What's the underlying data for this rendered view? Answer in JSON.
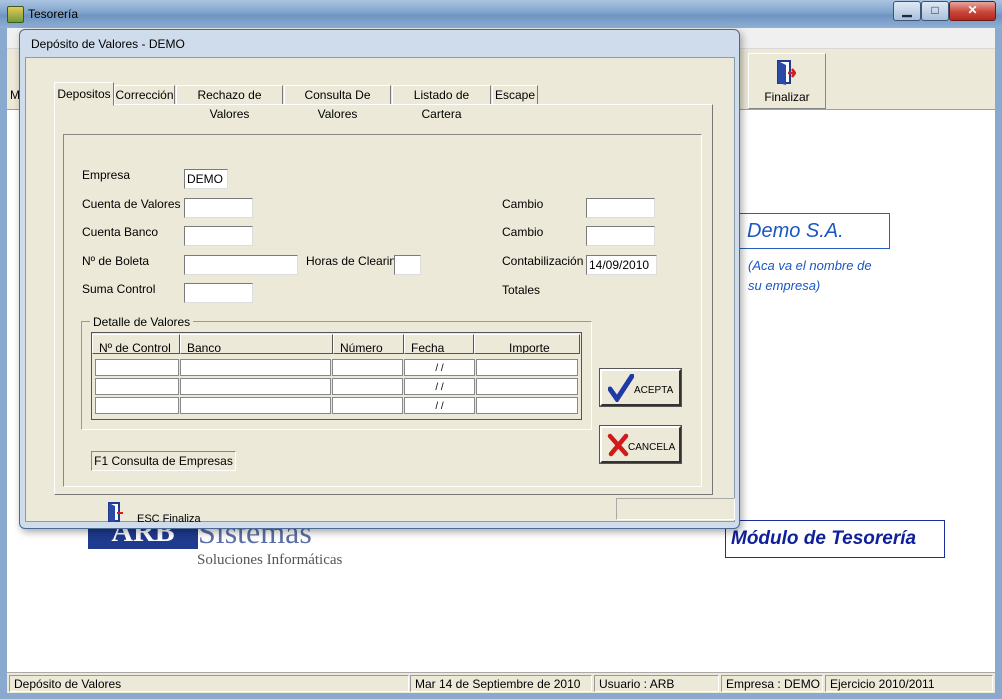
{
  "window": {
    "title": "Tesorería"
  },
  "caption_buttons": {
    "minimize": "▁",
    "maximize": "□",
    "close": "✕"
  },
  "toolbar": {
    "menu_letter": "M",
    "finalizar": "Finalizar"
  },
  "main": {
    "company_name": "Demo S.A.",
    "company_hint_1": "(Aca va el nombre de",
    "company_hint_2": "su empresa)",
    "module_title": "Módulo de Tesorería",
    "logo_arb": "ARB",
    "logo_sistemas": "Sistemas",
    "logo_subtitle": "Soluciones Informáticas",
    "esc_label": "ESC Finaliza"
  },
  "status_bar": [
    "Depósito de Valores",
    "Mar 14 de Septiembre de 2010",
    "Usuario : ARB",
    "Empresa : DEMO",
    "Ejercicio 2010/2011"
  ],
  "dialog": {
    "title": "Depósito de Valores  - DEMO",
    "tabs": [
      "Depositos",
      "Corrección",
      "Rechazo de Valores",
      "Consulta De Valores",
      "Listado de Cartera",
      "Escape"
    ],
    "labels": {
      "empresa": "Empresa",
      "cuenta_valores": "Cuenta de Valores",
      "cuenta_banco": "Cuenta Banco",
      "boleta": "Nº de Boleta",
      "horas_clearing": "Horas de Clearing",
      "suma_control": "Suma Control",
      "cambio1": "Cambio",
      "cambio2": "Cambio",
      "contabilizacion": "Contabilización",
      "totales": "Totales"
    },
    "values": {
      "empresa": "DEMO",
      "contabilizacion": "14/09/2010"
    },
    "detalle": {
      "title": "Detalle de Valores",
      "columns": [
        "Nº de Control",
        "Banco",
        "Número",
        "Fecha",
        "Importe"
      ],
      "date_placeholder": "/   /"
    },
    "buttons": {
      "acepta": "ACEPTA",
      "cancela": "CANCELA",
      "f1": "F1  Consulta de Empresas"
    }
  }
}
